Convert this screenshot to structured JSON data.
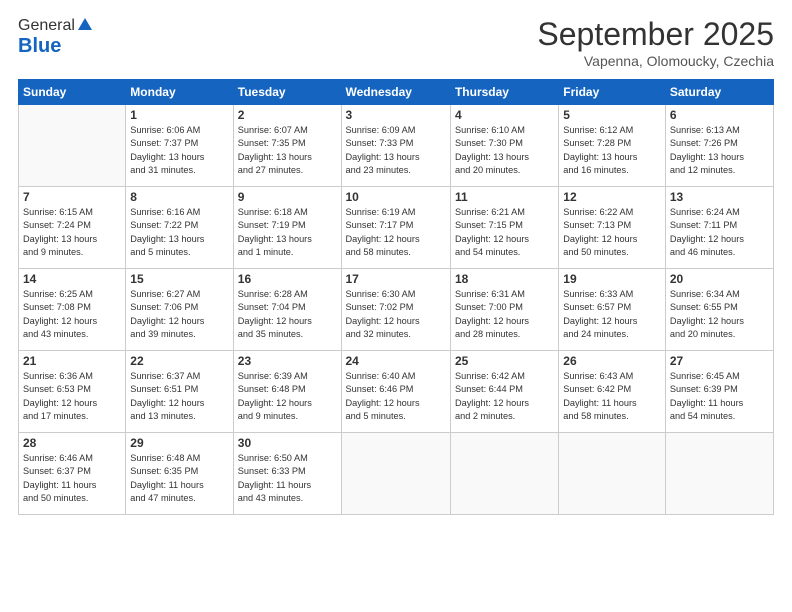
{
  "logo": {
    "general": "General",
    "blue": "Blue"
  },
  "title": "September 2025",
  "subtitle": "Vapenna, Olomoucky, Czechia",
  "days_header": [
    "Sunday",
    "Monday",
    "Tuesday",
    "Wednesday",
    "Thursday",
    "Friday",
    "Saturday"
  ],
  "weeks": [
    [
      {
        "day": "",
        "info": ""
      },
      {
        "day": "1",
        "info": "Sunrise: 6:06 AM\nSunset: 7:37 PM\nDaylight: 13 hours\nand 31 minutes."
      },
      {
        "day": "2",
        "info": "Sunrise: 6:07 AM\nSunset: 7:35 PM\nDaylight: 13 hours\nand 27 minutes."
      },
      {
        "day": "3",
        "info": "Sunrise: 6:09 AM\nSunset: 7:33 PM\nDaylight: 13 hours\nand 23 minutes."
      },
      {
        "day": "4",
        "info": "Sunrise: 6:10 AM\nSunset: 7:30 PM\nDaylight: 13 hours\nand 20 minutes."
      },
      {
        "day": "5",
        "info": "Sunrise: 6:12 AM\nSunset: 7:28 PM\nDaylight: 13 hours\nand 16 minutes."
      },
      {
        "day": "6",
        "info": "Sunrise: 6:13 AM\nSunset: 7:26 PM\nDaylight: 13 hours\nand 12 minutes."
      }
    ],
    [
      {
        "day": "7",
        "info": "Sunrise: 6:15 AM\nSunset: 7:24 PM\nDaylight: 13 hours\nand 9 minutes."
      },
      {
        "day": "8",
        "info": "Sunrise: 6:16 AM\nSunset: 7:22 PM\nDaylight: 13 hours\nand 5 minutes."
      },
      {
        "day": "9",
        "info": "Sunrise: 6:18 AM\nSunset: 7:19 PM\nDaylight: 13 hours\nand 1 minute."
      },
      {
        "day": "10",
        "info": "Sunrise: 6:19 AM\nSunset: 7:17 PM\nDaylight: 12 hours\nand 58 minutes."
      },
      {
        "day": "11",
        "info": "Sunrise: 6:21 AM\nSunset: 7:15 PM\nDaylight: 12 hours\nand 54 minutes."
      },
      {
        "day": "12",
        "info": "Sunrise: 6:22 AM\nSunset: 7:13 PM\nDaylight: 12 hours\nand 50 minutes."
      },
      {
        "day": "13",
        "info": "Sunrise: 6:24 AM\nSunset: 7:11 PM\nDaylight: 12 hours\nand 46 minutes."
      }
    ],
    [
      {
        "day": "14",
        "info": "Sunrise: 6:25 AM\nSunset: 7:08 PM\nDaylight: 12 hours\nand 43 minutes."
      },
      {
        "day": "15",
        "info": "Sunrise: 6:27 AM\nSunset: 7:06 PM\nDaylight: 12 hours\nand 39 minutes."
      },
      {
        "day": "16",
        "info": "Sunrise: 6:28 AM\nSunset: 7:04 PM\nDaylight: 12 hours\nand 35 minutes."
      },
      {
        "day": "17",
        "info": "Sunrise: 6:30 AM\nSunset: 7:02 PM\nDaylight: 12 hours\nand 32 minutes."
      },
      {
        "day": "18",
        "info": "Sunrise: 6:31 AM\nSunset: 7:00 PM\nDaylight: 12 hours\nand 28 minutes."
      },
      {
        "day": "19",
        "info": "Sunrise: 6:33 AM\nSunset: 6:57 PM\nDaylight: 12 hours\nand 24 minutes."
      },
      {
        "day": "20",
        "info": "Sunrise: 6:34 AM\nSunset: 6:55 PM\nDaylight: 12 hours\nand 20 minutes."
      }
    ],
    [
      {
        "day": "21",
        "info": "Sunrise: 6:36 AM\nSunset: 6:53 PM\nDaylight: 12 hours\nand 17 minutes."
      },
      {
        "day": "22",
        "info": "Sunrise: 6:37 AM\nSunset: 6:51 PM\nDaylight: 12 hours\nand 13 minutes."
      },
      {
        "day": "23",
        "info": "Sunrise: 6:39 AM\nSunset: 6:48 PM\nDaylight: 12 hours\nand 9 minutes."
      },
      {
        "day": "24",
        "info": "Sunrise: 6:40 AM\nSunset: 6:46 PM\nDaylight: 12 hours\nand 5 minutes."
      },
      {
        "day": "25",
        "info": "Sunrise: 6:42 AM\nSunset: 6:44 PM\nDaylight: 12 hours\nand 2 minutes."
      },
      {
        "day": "26",
        "info": "Sunrise: 6:43 AM\nSunset: 6:42 PM\nDaylight: 11 hours\nand 58 minutes."
      },
      {
        "day": "27",
        "info": "Sunrise: 6:45 AM\nSunset: 6:39 PM\nDaylight: 11 hours\nand 54 minutes."
      }
    ],
    [
      {
        "day": "28",
        "info": "Sunrise: 6:46 AM\nSunset: 6:37 PM\nDaylight: 11 hours\nand 50 minutes."
      },
      {
        "day": "29",
        "info": "Sunrise: 6:48 AM\nSunset: 6:35 PM\nDaylight: 11 hours\nand 47 minutes."
      },
      {
        "day": "30",
        "info": "Sunrise: 6:50 AM\nSunset: 6:33 PM\nDaylight: 11 hours\nand 43 minutes."
      },
      {
        "day": "",
        "info": ""
      },
      {
        "day": "",
        "info": ""
      },
      {
        "day": "",
        "info": ""
      },
      {
        "day": "",
        "info": ""
      }
    ]
  ]
}
